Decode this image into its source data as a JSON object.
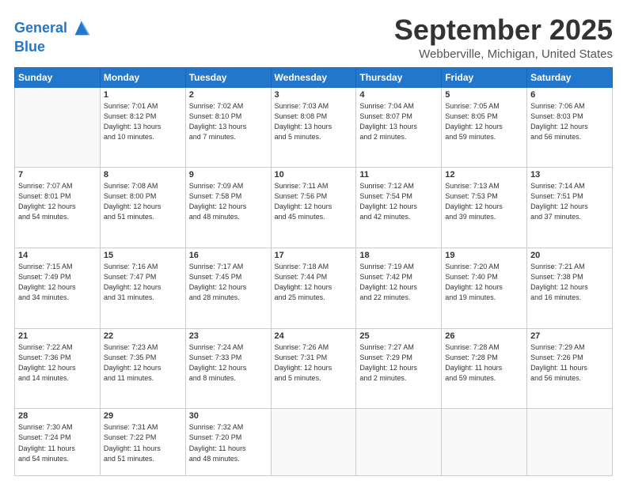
{
  "logo": {
    "line1": "General",
    "line2": "Blue"
  },
  "header": {
    "month": "September 2025",
    "location": "Webberville, Michigan, United States"
  },
  "days_of_week": [
    "Sunday",
    "Monday",
    "Tuesday",
    "Wednesday",
    "Thursday",
    "Friday",
    "Saturday"
  ],
  "weeks": [
    [
      {
        "day": "",
        "info": ""
      },
      {
        "day": "1",
        "info": "Sunrise: 7:01 AM\nSunset: 8:12 PM\nDaylight: 13 hours\nand 10 minutes."
      },
      {
        "day": "2",
        "info": "Sunrise: 7:02 AM\nSunset: 8:10 PM\nDaylight: 13 hours\nand 7 minutes."
      },
      {
        "day": "3",
        "info": "Sunrise: 7:03 AM\nSunset: 8:08 PM\nDaylight: 13 hours\nand 5 minutes."
      },
      {
        "day": "4",
        "info": "Sunrise: 7:04 AM\nSunset: 8:07 PM\nDaylight: 13 hours\nand 2 minutes."
      },
      {
        "day": "5",
        "info": "Sunrise: 7:05 AM\nSunset: 8:05 PM\nDaylight: 12 hours\nand 59 minutes."
      },
      {
        "day": "6",
        "info": "Sunrise: 7:06 AM\nSunset: 8:03 PM\nDaylight: 12 hours\nand 56 minutes."
      }
    ],
    [
      {
        "day": "7",
        "info": "Sunrise: 7:07 AM\nSunset: 8:01 PM\nDaylight: 12 hours\nand 54 minutes."
      },
      {
        "day": "8",
        "info": "Sunrise: 7:08 AM\nSunset: 8:00 PM\nDaylight: 12 hours\nand 51 minutes."
      },
      {
        "day": "9",
        "info": "Sunrise: 7:09 AM\nSunset: 7:58 PM\nDaylight: 12 hours\nand 48 minutes."
      },
      {
        "day": "10",
        "info": "Sunrise: 7:11 AM\nSunset: 7:56 PM\nDaylight: 12 hours\nand 45 minutes."
      },
      {
        "day": "11",
        "info": "Sunrise: 7:12 AM\nSunset: 7:54 PM\nDaylight: 12 hours\nand 42 minutes."
      },
      {
        "day": "12",
        "info": "Sunrise: 7:13 AM\nSunset: 7:53 PM\nDaylight: 12 hours\nand 39 minutes."
      },
      {
        "day": "13",
        "info": "Sunrise: 7:14 AM\nSunset: 7:51 PM\nDaylight: 12 hours\nand 37 minutes."
      }
    ],
    [
      {
        "day": "14",
        "info": "Sunrise: 7:15 AM\nSunset: 7:49 PM\nDaylight: 12 hours\nand 34 minutes."
      },
      {
        "day": "15",
        "info": "Sunrise: 7:16 AM\nSunset: 7:47 PM\nDaylight: 12 hours\nand 31 minutes."
      },
      {
        "day": "16",
        "info": "Sunrise: 7:17 AM\nSunset: 7:45 PM\nDaylight: 12 hours\nand 28 minutes."
      },
      {
        "day": "17",
        "info": "Sunrise: 7:18 AM\nSunset: 7:44 PM\nDaylight: 12 hours\nand 25 minutes."
      },
      {
        "day": "18",
        "info": "Sunrise: 7:19 AM\nSunset: 7:42 PM\nDaylight: 12 hours\nand 22 minutes."
      },
      {
        "day": "19",
        "info": "Sunrise: 7:20 AM\nSunset: 7:40 PM\nDaylight: 12 hours\nand 19 minutes."
      },
      {
        "day": "20",
        "info": "Sunrise: 7:21 AM\nSunset: 7:38 PM\nDaylight: 12 hours\nand 16 minutes."
      }
    ],
    [
      {
        "day": "21",
        "info": "Sunrise: 7:22 AM\nSunset: 7:36 PM\nDaylight: 12 hours\nand 14 minutes."
      },
      {
        "day": "22",
        "info": "Sunrise: 7:23 AM\nSunset: 7:35 PM\nDaylight: 12 hours\nand 11 minutes."
      },
      {
        "day": "23",
        "info": "Sunrise: 7:24 AM\nSunset: 7:33 PM\nDaylight: 12 hours\nand 8 minutes."
      },
      {
        "day": "24",
        "info": "Sunrise: 7:26 AM\nSunset: 7:31 PM\nDaylight: 12 hours\nand 5 minutes."
      },
      {
        "day": "25",
        "info": "Sunrise: 7:27 AM\nSunset: 7:29 PM\nDaylight: 12 hours\nand 2 minutes."
      },
      {
        "day": "26",
        "info": "Sunrise: 7:28 AM\nSunset: 7:28 PM\nDaylight: 11 hours\nand 59 minutes."
      },
      {
        "day": "27",
        "info": "Sunrise: 7:29 AM\nSunset: 7:26 PM\nDaylight: 11 hours\nand 56 minutes."
      }
    ],
    [
      {
        "day": "28",
        "info": "Sunrise: 7:30 AM\nSunset: 7:24 PM\nDaylight: 11 hours\nand 54 minutes."
      },
      {
        "day": "29",
        "info": "Sunrise: 7:31 AM\nSunset: 7:22 PM\nDaylight: 11 hours\nand 51 minutes."
      },
      {
        "day": "30",
        "info": "Sunrise: 7:32 AM\nSunset: 7:20 PM\nDaylight: 11 hours\nand 48 minutes."
      },
      {
        "day": "",
        "info": ""
      },
      {
        "day": "",
        "info": ""
      },
      {
        "day": "",
        "info": ""
      },
      {
        "day": "",
        "info": ""
      }
    ]
  ]
}
